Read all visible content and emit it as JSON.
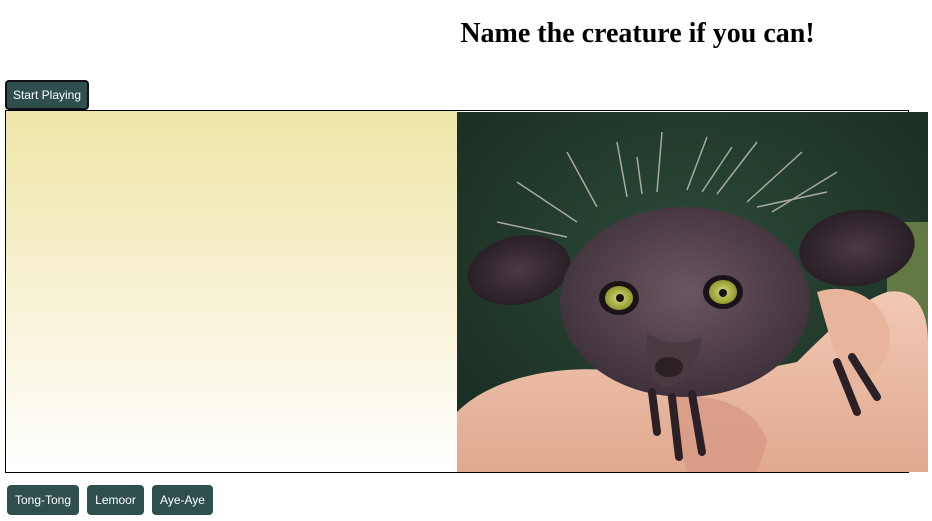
{
  "game": {
    "title": "Name the creature if you can!",
    "start_label": "Start Playing",
    "answers": [
      {
        "label": "Tong-Tong"
      },
      {
        "label": "Lemoor"
      },
      {
        "label": "Aye-Aye"
      }
    ]
  },
  "colors": {
    "button_bg": "#2f4f4f",
    "button_text": "#ffffff",
    "gradient_top": "#eee6a8",
    "gradient_bottom": "#ffffff",
    "photo_background": "#1e3a2c"
  },
  "icons": {
    "photo": "creature-photo-aye-aye"
  }
}
